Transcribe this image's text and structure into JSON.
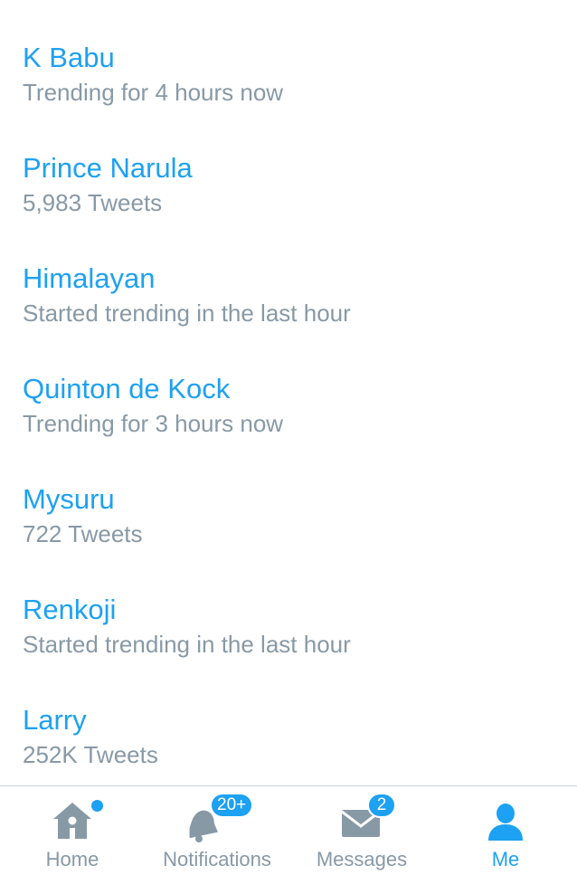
{
  "colors": {
    "accent": "#1da1f2",
    "muted": "#8899a6",
    "icon_gray": "#8899a6",
    "divider": "#c8ced3"
  },
  "trends": [
    {
      "name": "K Babu",
      "meta": "Trending for 4 hours now"
    },
    {
      "name": "Prince Narula",
      "meta": "5,983 Tweets"
    },
    {
      "name": "Himalayan",
      "meta": "Started trending in the last hour"
    },
    {
      "name": "Quinton de Kock",
      "meta": "Trending for 3 hours now"
    },
    {
      "name": "Mysuru",
      "meta": "722 Tweets"
    },
    {
      "name": "Renkoji",
      "meta": "Started trending in the last hour"
    },
    {
      "name": "Larry",
      "meta": "252K Tweets"
    }
  ],
  "tabbar": {
    "tabs": [
      {
        "label": "Home",
        "icon": "home-icon",
        "active": false
      },
      {
        "label": "Notifications",
        "icon": "bell-icon",
        "badge": "20+",
        "active": false
      },
      {
        "label": "Messages",
        "icon": "envelope-icon",
        "badge": "2",
        "active": false
      },
      {
        "label": "Me",
        "icon": "person-icon",
        "active": true
      }
    ]
  }
}
